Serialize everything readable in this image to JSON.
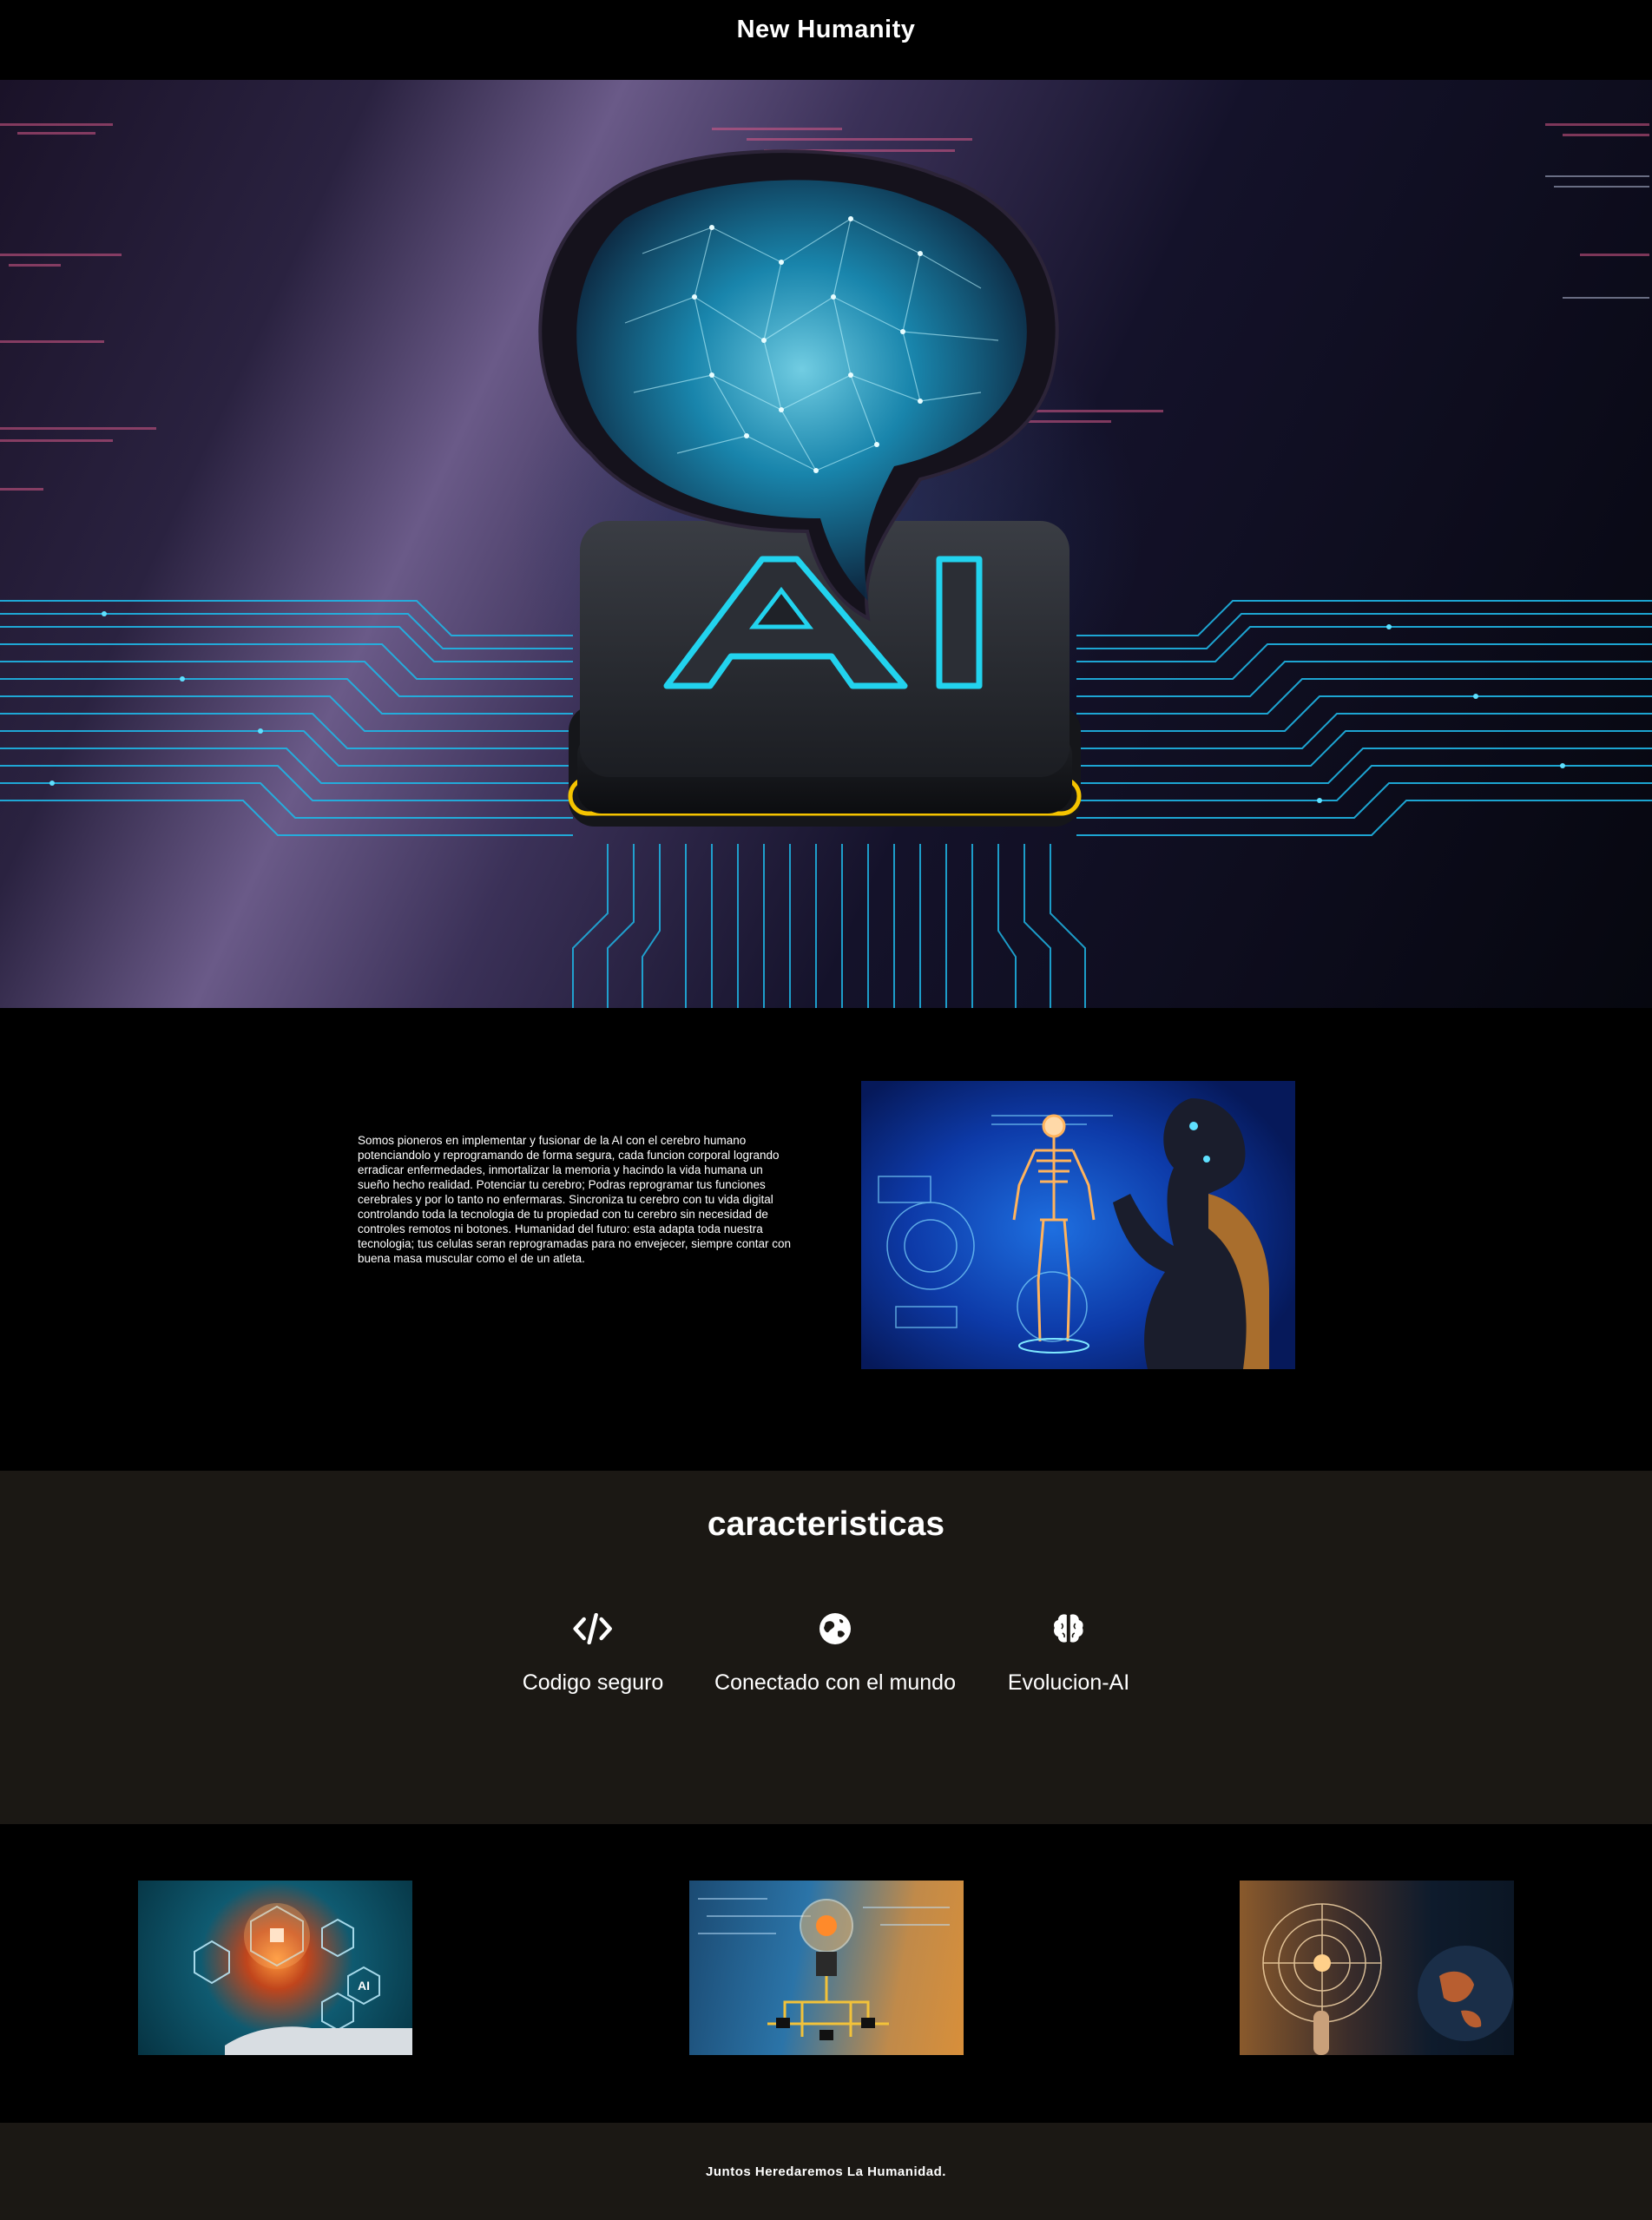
{
  "header": {
    "title": "New Humanity"
  },
  "hero": {
    "chip_text": "AI",
    "image_icon": "ai-brain-chip-image"
  },
  "about": {
    "text": "Somos pioneros en implementar y fusionar de la AI con el cerebro humano potenciandolo y reprogramando de forma segura, cada funcion corporal logrando erradicar enfermedades, inmortalizar la memoria y hacindo la vida humana un sueño hecho realidad. Potenciar tu cerebro; Podras reprogramar tus funciones cerebrales y por lo tanto no enfermaras. Sincroniza tu cerebro con tu vida digital controlando toda la tecnologia de tu propiedad con tu cerebro sin necesidad de controles remotos ni botones. Humanidad del futuro: esta adapta toda nuestra tecnologia; tus celulas seran reprogramadas para no envejecer, siempre contar con buena masa muscular como el de un atleta.",
    "image_icon": "robot-skeleton-hologram-image"
  },
  "features": {
    "title": "caracteristicas",
    "items": [
      {
        "label": "Codigo seguro",
        "icon": "code-icon"
      },
      {
        "label": "Conectado con el mundo",
        "icon": "globe-icon"
      },
      {
        "label": "Evolucion-AI",
        "icon": "brain-icon"
      }
    ]
  },
  "gallery": {
    "items": [
      {
        "icon": "robot-hand-ai-image"
      },
      {
        "icon": "lightbulb-circuit-image"
      },
      {
        "icon": "digital-earth-image"
      }
    ]
  },
  "footer": {
    "text": "Juntos Heredaremos La Humanidad."
  },
  "colors": {
    "background": "#000000",
    "section_dark": "#1b1814",
    "neon_cyan": "#22d3ee",
    "chip_gold": "#f5c400",
    "text": "#ffffff"
  }
}
